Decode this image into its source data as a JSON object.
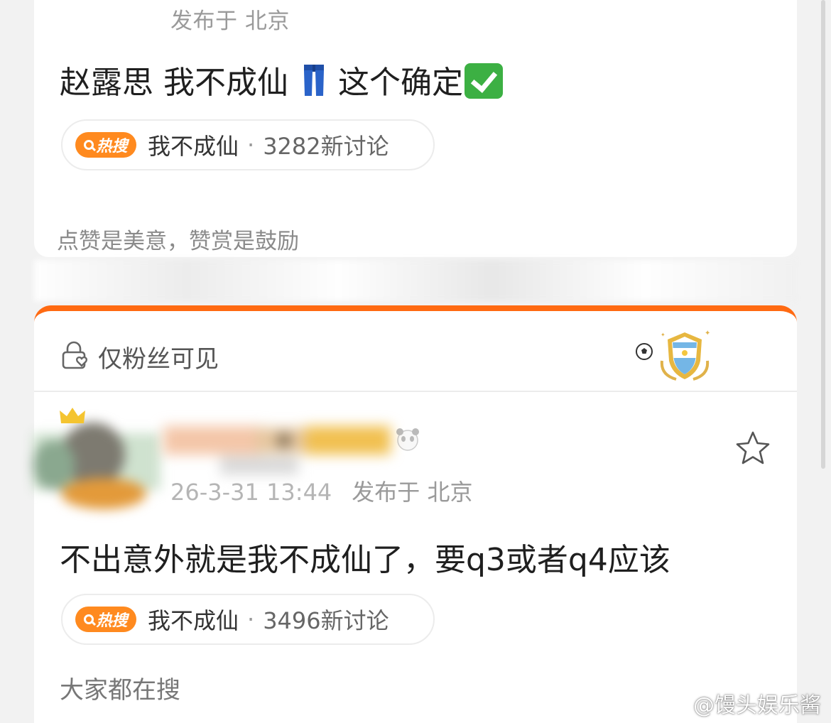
{
  "post_top": {
    "published": "发布于 北京",
    "text_before": "赵露思 我不成仙",
    "jeans_emoji": "jeans-icon",
    "text_after": "这个确定",
    "check_emoji": "check-mark-icon",
    "hot": {
      "badge": "热搜",
      "topic": "我不成仙",
      "dot": "·",
      "count": "3282新讨论"
    },
    "slogan": "点赞是美意，赞赏是鼓励"
  },
  "post_fans": {
    "visibility_label": "仅粉丝可见",
    "time": "26-3-31 13:44",
    "published": "发布于 北京",
    "text": "不出意外就是我不成仙了，要q3或者q4应该",
    "hot": {
      "badge": "热搜",
      "topic": "我不成仙",
      "dot": "·",
      "count": "3496新讨论"
    },
    "search_label": "大家都在搜"
  },
  "watermark": "@馒头娱乐酱",
  "colors": {
    "accent_orange": "#ff6a12",
    "hot_badge": "#ff8a1f",
    "text_main": "#1f1f1f",
    "text_muted": "#9a9a9a"
  }
}
